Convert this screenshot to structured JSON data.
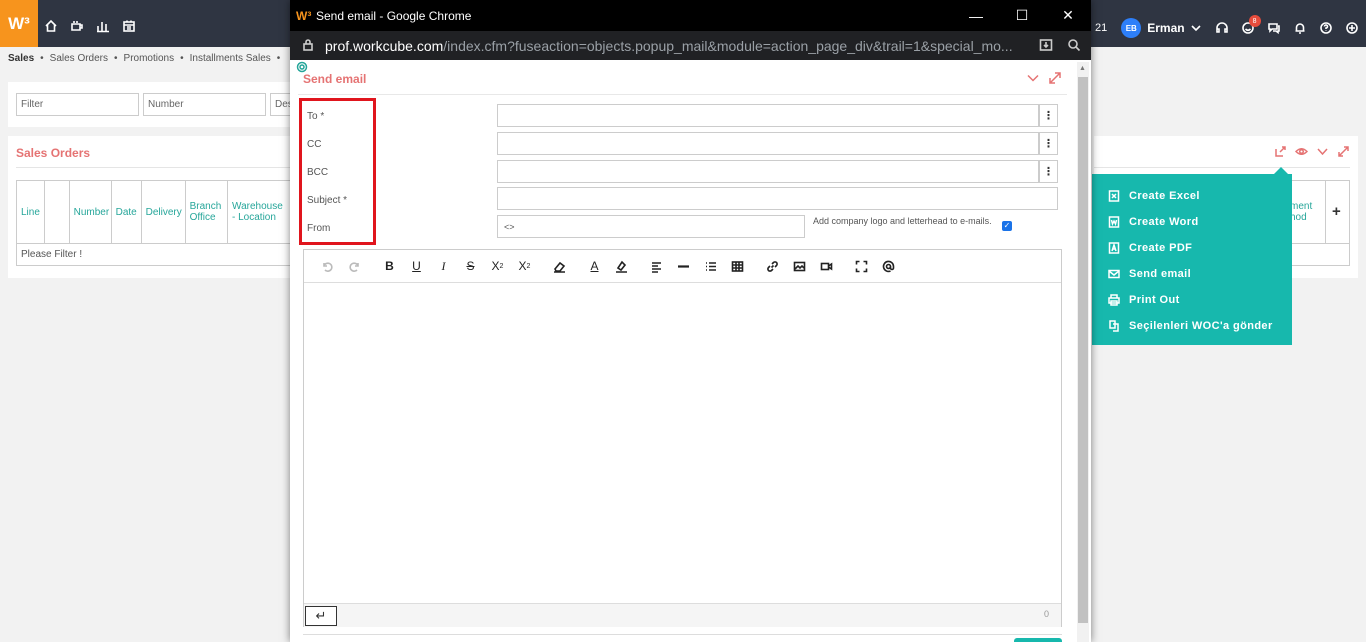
{
  "topbar": {
    "logo": "W³",
    "year": "21",
    "avatar_initials": "EB",
    "user_name": "Erman",
    "notification_count": "8",
    "icons": [
      "home-icon",
      "coffee-icon",
      "chart-icon",
      "calendar-icon",
      "headset-icon",
      "smile-icon",
      "chat-icon",
      "bell-icon",
      "help-icon",
      "grid-icon"
    ]
  },
  "breadcrumb": [
    "Sales",
    "Sales Orders",
    "Promotions",
    "Installments Sales"
  ],
  "filters": {
    "filter_placeholder": "Filter",
    "number_placeholder": "Number",
    "desc_placeholder": "Des"
  },
  "orders": {
    "title": "Sales Orders",
    "columns": [
      "Line",
      "",
      "Number",
      "Date",
      "Delivery",
      "Branch Office",
      "Warehouse - Location"
    ],
    "right_column": "ment hod",
    "empty_text": "Please Filter !",
    "add_symbol": "+"
  },
  "menu": {
    "items": [
      {
        "label": "Create Excel",
        "icon": "excel-icon"
      },
      {
        "label": "Create Word",
        "icon": "word-icon"
      },
      {
        "label": "Create PDF",
        "icon": "pdf-icon"
      },
      {
        "label": "Send email",
        "icon": "mail-icon"
      },
      {
        "label": "Print Out",
        "icon": "print-icon"
      },
      {
        "label": "Seçilenleri WOC'a gönder",
        "icon": "document-send-icon"
      }
    ]
  },
  "window": {
    "logo": "W³",
    "title": "Send email - Google Chrome",
    "url_host": "prof.workcube.com",
    "url_path": "/index.cfm?fuseaction=objects.popup_mail&module=action_page_div&trail=1&special_mo..."
  },
  "form": {
    "title": "Send email",
    "to_label": "To *",
    "cc_label": "CC",
    "bcc_label": "BCC",
    "subject_label": "Subject *",
    "from_label": "From",
    "from_value": "<>",
    "logo_option_label": "Add company logo and letterhead to e-mails.",
    "logo_option_checked": "✓",
    "char_count": "0",
    "enter_symbol": "↵"
  },
  "colors": {
    "accent": "#17b8ad",
    "title_red": "#e57373",
    "highlight_red": "#e0151d",
    "logo_orange": "#f7941d"
  }
}
